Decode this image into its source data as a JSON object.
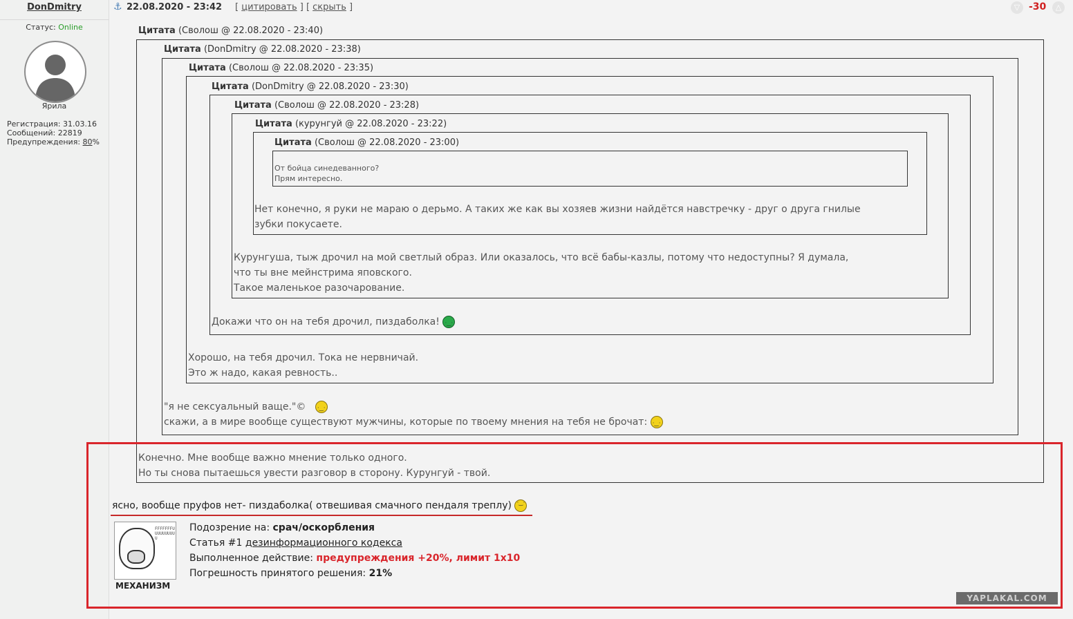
{
  "user": {
    "name": "DonDmitry",
    "status_label": "Статус:",
    "status_value": "Online",
    "rank": "Ярила",
    "registration": "Регистрация: 31.03.16",
    "messages": "Сообщений: 22819",
    "warnings_label": "Предупреждения:",
    "warnings_value": "80",
    "warnings_suffix": "%"
  },
  "post": {
    "date": "22.08.2020 - 23:42",
    "quote_link": "цитировать",
    "hide_link": "скрыть",
    "score": "-30",
    "final_text": "ясно, вообще пруфов нет- пиздаболка( отвешивая смачного пендаля треплу)"
  },
  "quotes": [
    {
      "label": "Цитата",
      "meta": "(Сволош @ 22.08.2020 - 23:40)",
      "text": [
        "Конечно. Мне вообще важно мнение только одного.",
        "Но ты снова пытаешься увести разговор в сторону. Курунгуй - твой."
      ]
    },
    {
      "label": "Цитата",
      "meta": "(DonDmitry @ 22.08.2020 - 23:38)",
      "text": [
        "\"я не сексуальный ваще.\"©",
        "скажи, а в мире вообще существуют мужчины, которые по твоему мнения на тебя не брочат:"
      ]
    },
    {
      "label": "Цитата",
      "meta": "(Сволош @ 22.08.2020 - 23:35)",
      "text": [
        "Хорошо, на тебя дрочил. Тока не нервничай.",
        "Это ж надо, какая ревность.."
      ]
    },
    {
      "label": "Цитата",
      "meta": "(DonDmitry @ 22.08.2020 - 23:30)",
      "text": [
        "Докажи что он на тебя дрочил, пиздаболка!"
      ]
    },
    {
      "label": "Цитата",
      "meta": "(Сволош @ 22.08.2020 - 23:28)",
      "text": [
        "Курунгуша, тыж дрочил на мой светлый образ. Или оказалось, что всё бабы-казлы, потому что недоступны? Я думала,",
        "что ты вне мейнстрима яповского.",
        "Такое маленькое разочарование."
      ]
    },
    {
      "label": "Цитата",
      "meta": "(курунгуй @ 22.08.2020 - 23:22)",
      "text": [
        "Нет конечно, я руки не мараю о дерьмо. А таких же как вы хозяев жизни найдётся навстречку - друг о друга гнилые",
        "зубки покусаете."
      ]
    },
    {
      "label": "Цитата",
      "meta": "(Сволош @ 22.08.2020 - 23:00)",
      "text": [
        "От бойца синедеванного?",
        "Прям интересно."
      ]
    }
  ],
  "mechanism": {
    "label": "МЕХАНИЗМ",
    "face_text": "FFFFFFFUUUUUUUUUU",
    "suspicion_label": "Подозрение на:",
    "suspicion_value": "срач/оскорбления",
    "article_prefix": "Статья #1",
    "article_link": "дезинформационного кодекса",
    "action_label": "Выполненное действие:",
    "action_value": "предупреждения +20%, лимит 1x10",
    "error_label": "Погрешность принятого решения:",
    "error_value": "21%"
  },
  "watermark": "YAPLAKAL.COM",
  "colors": {
    "status_online": "#2a9d2a",
    "score": "#d02020",
    "highlight_frame": "#d9252b"
  }
}
